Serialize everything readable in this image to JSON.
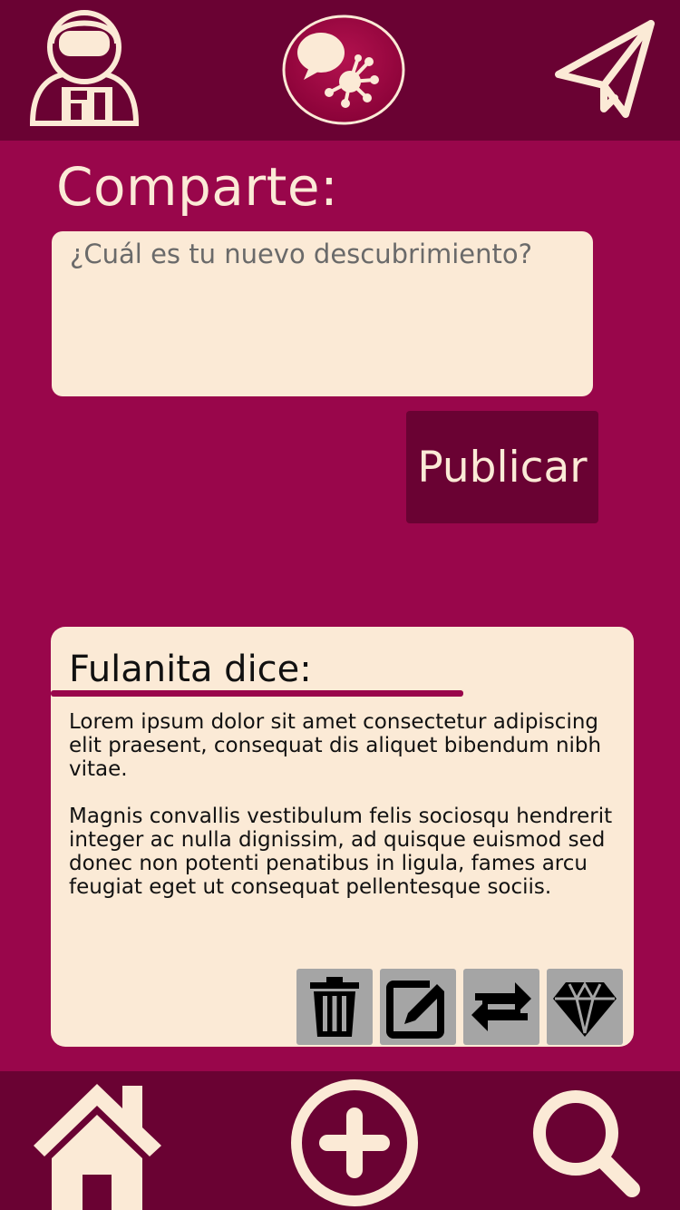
{
  "colors": {
    "primary": "#99064b",
    "dark": "#6a0233",
    "cream": "#fbead6",
    "action_bg": "#a5a5a5"
  },
  "header": {
    "profile_icon": "astronaut-avatar-icon",
    "logo_icon": "network-chat-logo-icon",
    "send_icon": "paper-plane-icon"
  },
  "share": {
    "title": "Comparte:",
    "placeholder": "¿Cuál es tu nuevo descubrimiento?",
    "value": "",
    "publish_label": "Publicar"
  },
  "post": {
    "author_line": "Fulanita dice:",
    "paragraphs": [
      "Lorem ipsum dolor sit amet consectetur adipiscing elit praesent, consequat dis aliquet bibendum nibh vitae.",
      "Magnis convallis vestibulum felis sociosqu hendrerit integer ac nulla dignissim, ad quisque euismod sed donec non potenti penatibus in ligula, fames arcu feugiat eget ut consequat pellentesque sociis."
    ],
    "actions": [
      "trash-icon",
      "edit-icon",
      "repost-icon",
      "diamond-icon"
    ]
  },
  "bottom_nav": {
    "items": [
      "home-icon",
      "add-icon",
      "search-icon"
    ]
  }
}
